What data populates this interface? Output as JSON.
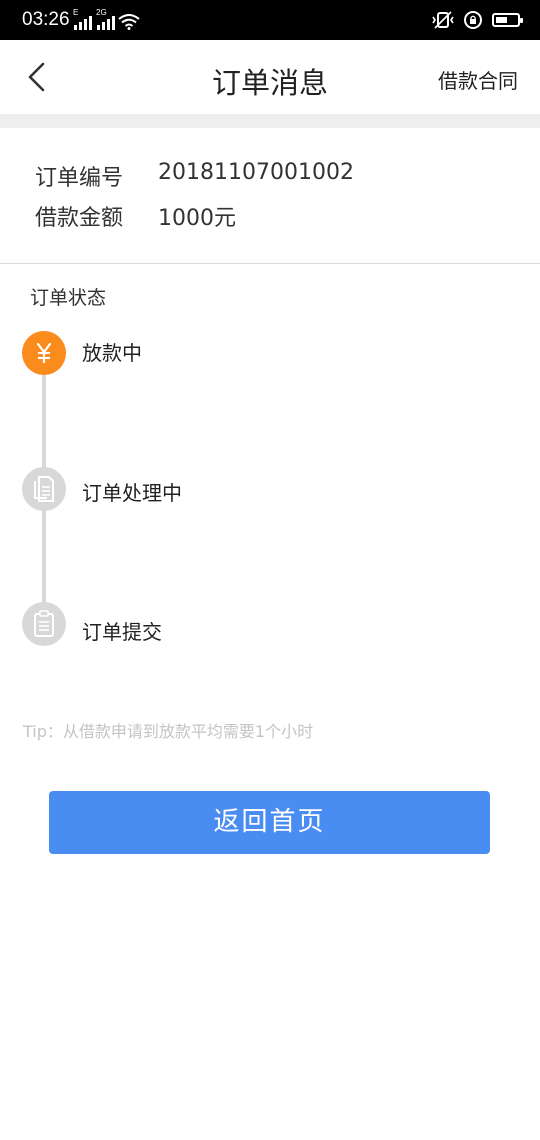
{
  "status_bar": {
    "time": "03:26",
    "network_1": "E",
    "network_2": "2G"
  },
  "nav": {
    "title": "订单消息",
    "right_link": "借款合同",
    "back_icon": "chevron-left-icon"
  },
  "order_info": {
    "order_no_label": "订单编号",
    "order_no_value": "20181107001002",
    "amount_label": "借款金额",
    "amount_value": "1000元"
  },
  "status_section": {
    "title": "订单状态",
    "steps": [
      {
        "label": "放款中",
        "icon": "yuan-icon",
        "active": true
      },
      {
        "label": "订单处理中",
        "icon": "documents-icon",
        "active": false
      },
      {
        "label": "订单提交",
        "icon": "clipboard-icon",
        "active": false
      }
    ]
  },
  "tip": "Tip：从借款申请到放款平均需要1个小时",
  "home_button": "返回首页",
  "colors": {
    "accent": "#4a8df2",
    "active_step": "#f98c1c",
    "inactive_step": "#d8d8d8"
  }
}
